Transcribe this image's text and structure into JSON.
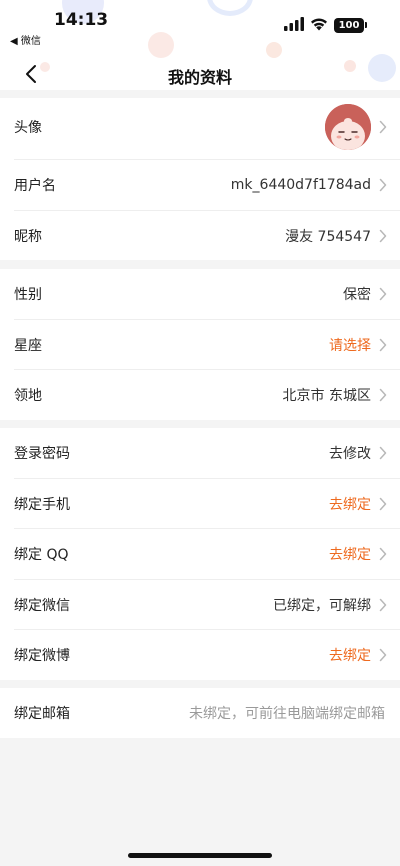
{
  "status_bar": {
    "time": "14:13",
    "back_app": "◀ 微信",
    "battery": "100"
  },
  "nav": {
    "title": "我的资料"
  },
  "sections": [
    {
      "rows": [
        {
          "label": "头像",
          "type": "avatar"
        },
        {
          "label": "用户名",
          "value": "mk_6440d7f1784ad"
        },
        {
          "label": "昵称",
          "value": "漫友 754547"
        }
      ]
    },
    {
      "rows": [
        {
          "label": "性别",
          "value": "保密"
        },
        {
          "label": "星座",
          "value": "请选择",
          "accent": true
        },
        {
          "label": "领地",
          "value": "北京市 东城区"
        }
      ]
    },
    {
      "rows": [
        {
          "label": "登录密码",
          "value": "去修改"
        },
        {
          "label": "绑定手机",
          "value": "去绑定",
          "accent": true
        },
        {
          "label": "绑定 QQ",
          "value": "去绑定",
          "accent": true
        },
        {
          "label": "绑定微信",
          "value": "已绑定，可解绑"
        },
        {
          "label": "绑定微博",
          "value": "去绑定",
          "accent": true
        }
      ]
    },
    {
      "rows": [
        {
          "label": "绑定邮箱",
          "value": "未绑定，可前往电脑端绑定邮箱",
          "muted": true
        }
      ]
    }
  ],
  "colors": {
    "accent": "#ee6a1f",
    "muted": "#9a9a9a",
    "background": "#f4f4f4"
  }
}
